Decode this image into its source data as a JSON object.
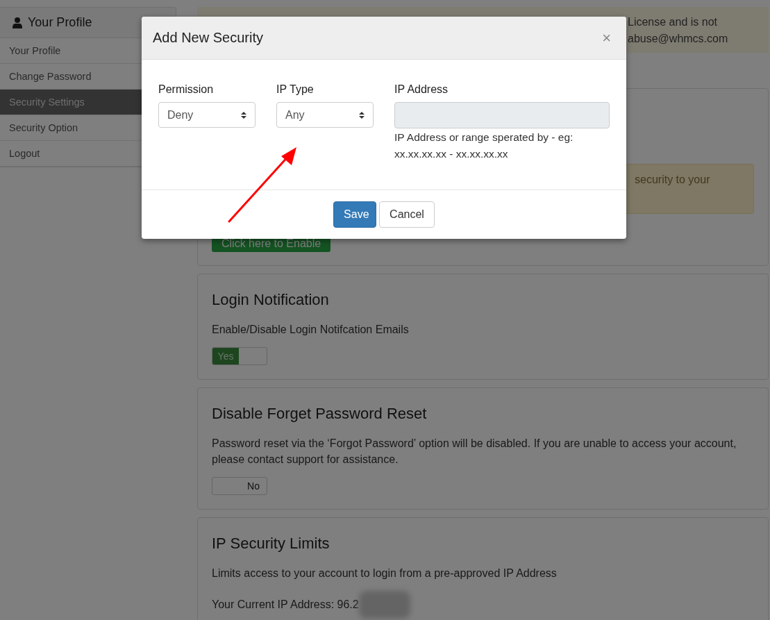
{
  "sidebar": {
    "title": "Your Profile",
    "items": [
      {
        "label": "Your Profile",
        "selected": false
      },
      {
        "label": "Change Password",
        "selected": false
      },
      {
        "label": "Security Settings",
        "selected": true
      },
      {
        "label": "Security Option",
        "selected": false
      },
      {
        "label": "Logout",
        "selected": false
      }
    ]
  },
  "banner": {
    "lines": [
      "License and is not",
      "abuse@whmcs.com"
    ]
  },
  "sections": [
    {
      "kind": "alert-action",
      "alert": "security to your",
      "button": "Click here to Enable"
    },
    {
      "kind": "toggle",
      "title": "Login Notification",
      "description": "Enable/Disable Login Notifcation Emails",
      "toggle": {
        "on": true,
        "label": "Yes"
      }
    },
    {
      "kind": "toggle",
      "title": "Disable Forget Password Reset",
      "description": "Password reset via the ‘Forgot Password’ option will be disabled. If you are unable to access your account, please contact support for assistance.",
      "toggle": {
        "on": false,
        "label": "No"
      }
    },
    {
      "kind": "ip",
      "title": "IP Security Limits",
      "description": "Limits access to your account to login from a pre-approved IP Address",
      "current_ip": "Your Current IP Address: 96.2"
    }
  ],
  "modal": {
    "title": "Add New Security",
    "close": "×",
    "fields": [
      {
        "kind": "select",
        "label": "Permission",
        "value": "Deny"
      },
      {
        "kind": "select",
        "label": "IP Type",
        "value": "Any"
      },
      {
        "kind": "input",
        "label": "IP Address",
        "help": "IP Address or range sperated by - eg: xx.xx.xx.xx - xx.xx.xx.xx"
      }
    ],
    "buttons": [
      {
        "label": "Save",
        "kind": "primary"
      },
      {
        "label": "Cancel",
        "kind": "default"
      }
    ]
  }
}
